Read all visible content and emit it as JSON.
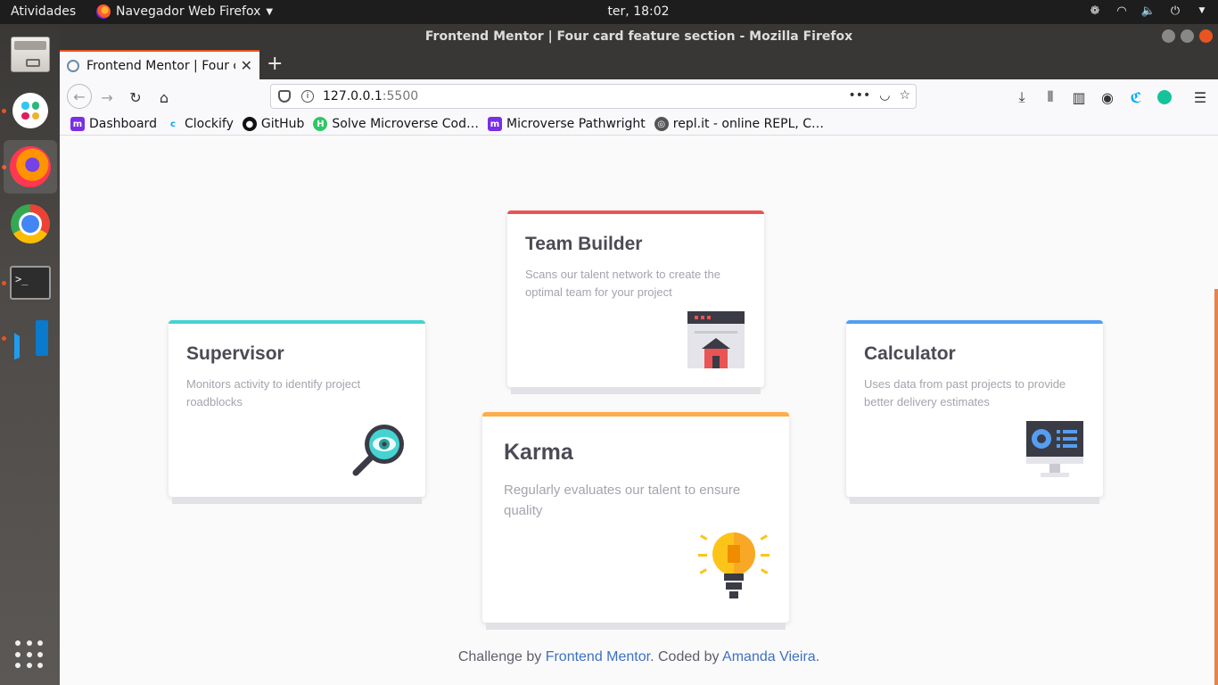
{
  "topbar": {
    "activities": "Atividades",
    "app_name": "Navegador Web Firefox",
    "clock": "ter, 18:02"
  },
  "window": {
    "title": "Frontend Mentor | Four card feature section - Mozilla Firefox"
  },
  "tab": {
    "title": "Frontend Mentor | Four c",
    "close": "✕",
    "new_tab": "+"
  },
  "urlbar": {
    "host": "127.0.0.1",
    "port": ":5500",
    "more": "•••"
  },
  "bookmarks": [
    {
      "label": "Dashboard",
      "icon": "m",
      "color": "#7b2ee6"
    },
    {
      "label": "Clockify",
      "icon": "c",
      "color": "#03a9f4"
    },
    {
      "label": "GitHub",
      "icon": "gh",
      "color": "#111111"
    },
    {
      "label": "Solve Microverse Cod…",
      "icon": "H",
      "color": "#2ec866"
    },
    {
      "label": "Microverse Pathwright",
      "icon": "m",
      "color": "#7b2ee6"
    },
    {
      "label": "repl.it - online REPL, C…",
      "icon": "r",
      "color": "#555555"
    }
  ],
  "cards": {
    "supervisor": {
      "title": "Supervisor",
      "text": "Monitors activity to identify project roadblocks",
      "accent": "#44d3d2"
    },
    "team_builder": {
      "title": "Team Builder",
      "text": "Scans our talent network to create the optimal team for your project",
      "accent": "#ea5454"
    },
    "karma": {
      "title": "Karma",
      "text": "Regularly evaluates our talent to ensure quality",
      "accent": "#fcae4a"
    },
    "calculator": {
      "title": "Calculator",
      "text": "Uses data from past projects to provide better delivery estimates",
      "accent": "#549ef2"
    }
  },
  "footer": {
    "prefix": "Challenge by ",
    "link1": "Frontend Mentor",
    "middle": ". Coded by ",
    "link2": "Amanda Vieira",
    "suffix": "."
  }
}
